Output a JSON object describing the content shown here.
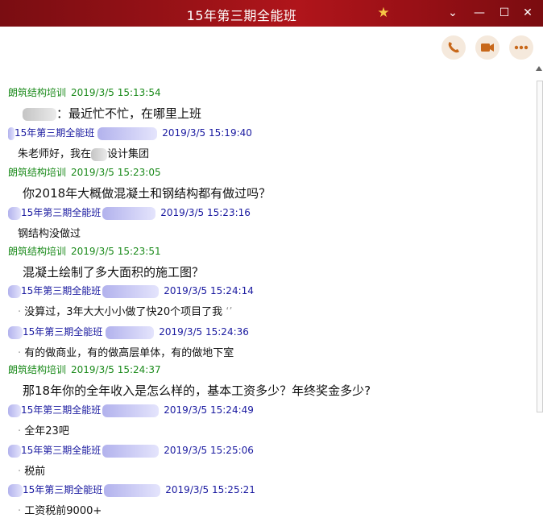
{
  "window": {
    "title": "15年第三期全能班",
    "buttons": {
      "pin": "★",
      "dropdown": "⌄",
      "minimize": "—",
      "maximize": "☐",
      "close": "✕"
    }
  },
  "actions": [
    "phone-icon",
    "video-icon",
    "more-icon"
  ],
  "messages": [
    {
      "sender": "朗筑结构培训",
      "time": "2019/3/5 15:13:54",
      "text": "：最近忙不忙，在哪里上班",
      "role": "teacher"
    },
    {
      "sender": "15年第三期全能班",
      "time": "2019/3/5 15:19:40",
      "text_a": "朱老师好，我在",
      "text_b": "设计集团",
      "role": "student"
    },
    {
      "sender": "朗筑结构培训",
      "time": "2019/3/5 15:23:05",
      "text": "你2018年大概做混凝土和钢结构都有做过吗？",
      "role": "teacher"
    },
    {
      "sender": "15年第三期全能班",
      "time": "2019/3/5 15:23:16",
      "text": "钢结构没做过",
      "role": "student"
    },
    {
      "sender": "朗筑结构培训",
      "time": "2019/3/5 15:23:51",
      "text": "混凝土绘制了多大面积的施工图？",
      "role": "teacher"
    },
    {
      "sender": "15年第三期全能班",
      "time": "2019/3/5 15:24:14",
      "text": "没算过，3年大大小小做了快20个项目了我",
      "role": "student"
    },
    {
      "sender": "15年第三期全能班",
      "time": "2019/3/5 15:24:36",
      "text": "有的做商业，有的做高层单体，有的做地下室",
      "role": "student"
    },
    {
      "sender": "朗筑结构培训",
      "time": "2019/3/5 15:24:37",
      "text": "那18年你的全年收入是怎么样的，基本工资多少？年终奖金多少?",
      "role": "teacher"
    },
    {
      "sender": "15年第三期全能班",
      "time": "2019/3/5 15:24:49",
      "text": "全年23吧",
      "role": "student"
    },
    {
      "sender": "15年第三期全能班",
      "time": "2019/3/5 15:25:06",
      "text": "税前",
      "role": "student"
    },
    {
      "sender": "15年第三期全能班",
      "time": "2019/3/5 15:25:21",
      "text": "工资税前9000+",
      "role": "student"
    }
  ]
}
